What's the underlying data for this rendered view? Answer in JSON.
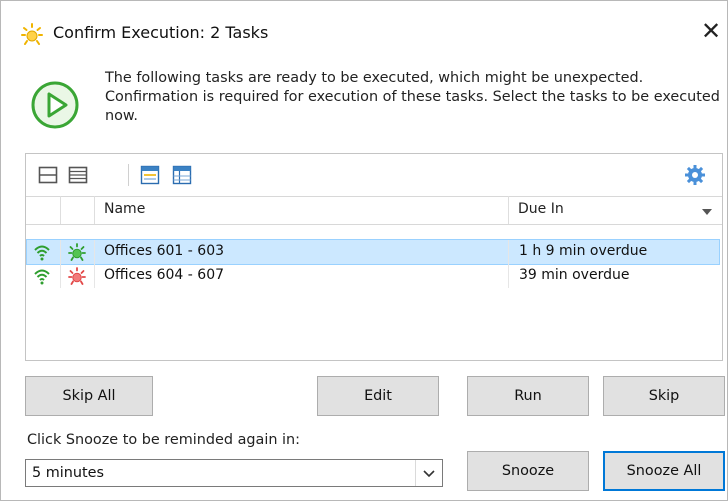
{
  "window": {
    "title": "Confirm Execution: 2 Tasks",
    "close_glyph": "✕"
  },
  "message": "The following tasks are ready to be executed, which might be unexpected. Confirmation is required for execution of these tasks. Select the tasks to be executed now.",
  "grid": {
    "columns": [
      "Name",
      "Due In"
    ],
    "rows": [
      {
        "name": "Offices 601 - 603",
        "due": "1 h 9 min overdue",
        "selected": true,
        "status_icon": "green-task-icon"
      },
      {
        "name": "Offices 604 - 607",
        "due": "39 min overdue",
        "selected": false,
        "status_icon": "red-task-icon"
      }
    ]
  },
  "buttons": {
    "skip_all": "Skip All",
    "edit": "Edit",
    "run": "Run",
    "skip": "Skip",
    "snooze": "Snooze",
    "snooze_all": "Snooze All"
  },
  "snooze": {
    "label": "Click Snooze to be reminded again in:",
    "value": "5 minutes"
  },
  "colors": {
    "accent": "#0078d7",
    "selection": "#cce8ff",
    "run_green": "#3aa635",
    "task_green": "#2e9e2e",
    "task_red": "#e24848"
  }
}
